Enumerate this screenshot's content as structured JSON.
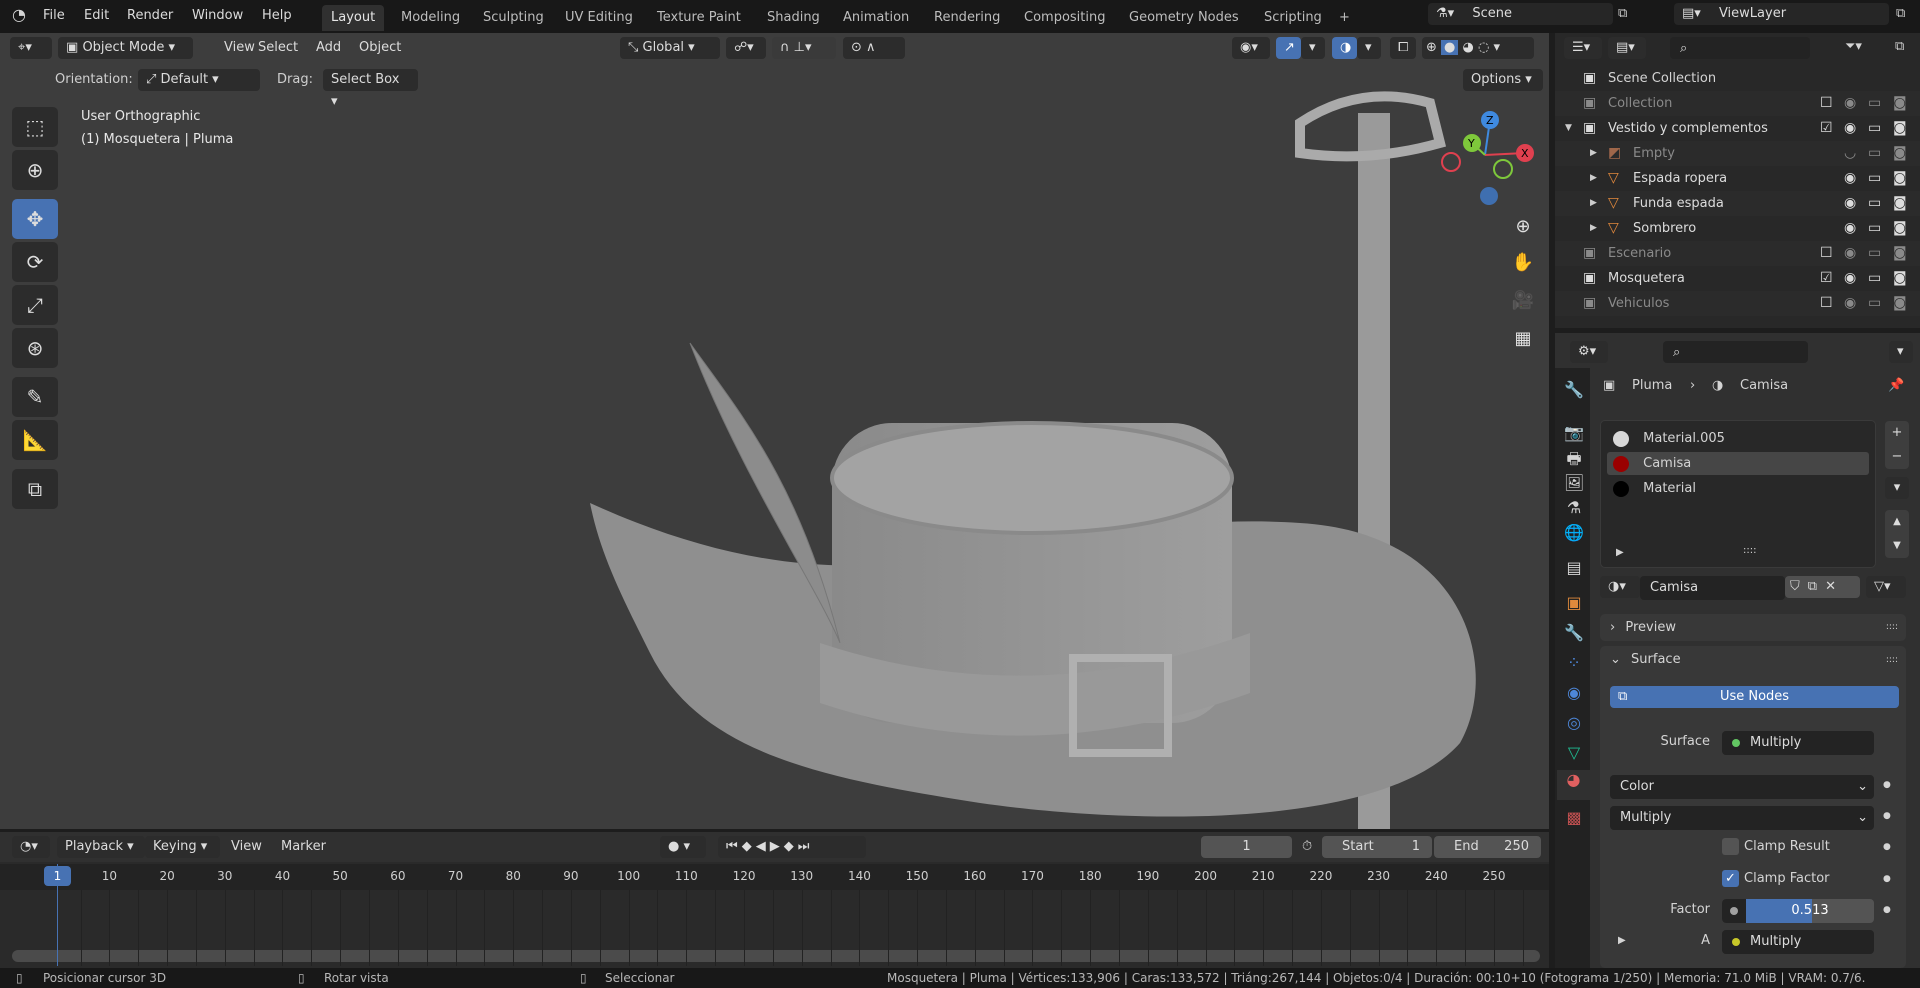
{
  "topbar": {
    "menus": [
      "File",
      "Edit",
      "Render",
      "Window",
      "Help"
    ],
    "workspaces": [
      "Layout",
      "Modeling",
      "Sculpting",
      "UV Editing",
      "Texture Paint",
      "Shading",
      "Animation",
      "Rendering",
      "Compositing",
      "Geometry Nodes",
      "Scripting"
    ],
    "active_workspace": "Layout",
    "add_workspace": "+",
    "scene": "Scene",
    "view_layer": "ViewLayer"
  },
  "viewport_header": {
    "mode": "Object Mode",
    "menus": [
      "View",
      "Select",
      "Add",
      "Object"
    ],
    "transform_orientation": "Global",
    "orientation_label": "Orientation:",
    "orientation_value": "Default",
    "drag_label": "Drag:",
    "drag_value": "Select Box",
    "options": "Options"
  },
  "viewport": {
    "view_name": "User Orthographic",
    "object_info": "(1) Mosquetera | Pluma",
    "gizmo_axes": {
      "x": "X",
      "y": "Y",
      "z": "Z"
    },
    "colors": {
      "background": "#3d3d3d",
      "x_axis": "#e0404f",
      "y_axis": "#7ec83b",
      "z_axis": "#3f8ae0",
      "active": "#4772b3"
    }
  },
  "tools": [
    "select-box",
    "cursor",
    "move",
    "rotate",
    "scale",
    "transform",
    "annotate",
    "measure",
    "add-cube"
  ],
  "outliner": {
    "root": "Scene Collection",
    "rows": [
      {
        "label": "Collection",
        "type": "collection",
        "checked": false,
        "dim": true,
        "depth": 1
      },
      {
        "label": "Vestido y complementos",
        "type": "collection",
        "checked": true,
        "dim": false,
        "depth": 1,
        "expanded": true
      },
      {
        "label": "Empty",
        "type": "empty",
        "dim": true,
        "depth": 2
      },
      {
        "label": "Espada ropera",
        "type": "mesh",
        "dim": false,
        "depth": 2
      },
      {
        "label": "Funda espada",
        "type": "mesh",
        "dim": false,
        "depth": 2
      },
      {
        "label": "Sombrero",
        "type": "mesh",
        "dim": false,
        "depth": 2
      },
      {
        "label": "Escenario",
        "type": "collection",
        "checked": false,
        "dim": true,
        "depth": 1
      },
      {
        "label": "Mosquetera",
        "type": "collection",
        "checked": true,
        "dim": false,
        "depth": 1
      },
      {
        "label": "Vehiculos",
        "type": "collection",
        "checked": false,
        "dim": true,
        "depth": 1
      }
    ]
  },
  "properties": {
    "breadcrumb": {
      "object": "Pluma",
      "material": "Camisa"
    },
    "material_slots": [
      {
        "name": "Material.005",
        "color": "#d8d8d8",
        "selected": false
      },
      {
        "name": "Camisa",
        "color": "#9a0000",
        "selected": true
      },
      {
        "name": "Material",
        "color": "#000000",
        "selected": false
      }
    ],
    "material_name": "Camisa",
    "preview_panel": "Preview",
    "surface_panel": "Surface",
    "use_nodes": "Use Nodes",
    "surface_label": "Surface",
    "surface_value": "Multiply",
    "color_dropdown": "Color",
    "blend_dropdown": "Multiply",
    "clamp_result": {
      "label": "Clamp Result",
      "checked": false
    },
    "clamp_factor": {
      "label": "Clamp Factor",
      "checked": true
    },
    "factor_label": "Factor",
    "factor_value": "0.513",
    "factor_fraction": 0.513,
    "a_label": "A",
    "a_value": "Multiply"
  },
  "timeline": {
    "menus": [
      "Playback",
      "Keying",
      "View",
      "Marker"
    ],
    "current_frame": "1",
    "start_label": "Start",
    "start": "1",
    "end_label": "End",
    "end": "250",
    "ticks": [
      "10",
      "20",
      "30",
      "40",
      "50",
      "60",
      "70",
      "80",
      "90",
      "100",
      "110",
      "120",
      "130",
      "140",
      "150",
      "160",
      "170",
      "180",
      "190",
      "200",
      "210",
      "220",
      "230",
      "240",
      "250"
    ]
  },
  "statusbar": {
    "hints": [
      "Posicionar cursor 3D",
      "Rotar vista",
      "Seleccionar"
    ],
    "stats": "Mosquetera | Pluma | Vértices:133,906 | Caras:133,572 | Triáng:267,144 | Objetos:0/4 | Duración: 00:10+10 (Fotograma 1/250) | Memoria: 71.0 MiB | VRAM: 0.7/6."
  }
}
